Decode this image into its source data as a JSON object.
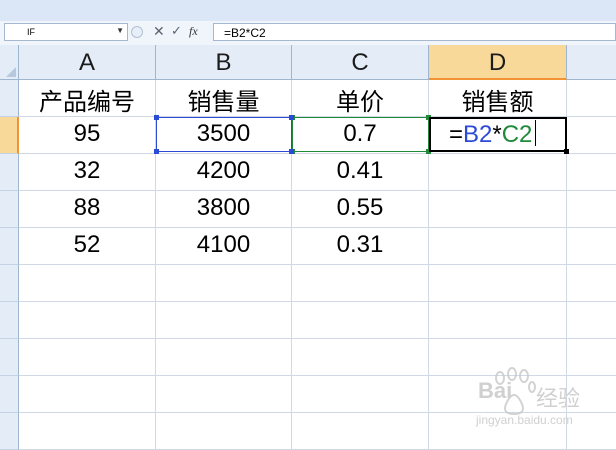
{
  "formula_bar": {
    "name_box": "IF",
    "fx_label": "fx",
    "formula": "=B2*C2"
  },
  "columns": [
    "A",
    "B",
    "C",
    "D"
  ],
  "header_row": {
    "A": "产品编号",
    "B": "销售量",
    "C": "单价",
    "D": "销售额"
  },
  "rows": [
    {
      "A": "95",
      "B": "3500",
      "C": "0.7",
      "D": ""
    },
    {
      "A": "32",
      "B": "4200",
      "C": "0.41",
      "D": ""
    },
    {
      "A": "88",
      "B": "3800",
      "C": "0.55",
      "D": ""
    },
    {
      "A": "52",
      "B": "4100",
      "C": "0.31",
      "D": ""
    }
  ],
  "editing_cell": {
    "eq": "=",
    "ref1": "B2",
    "op": "*",
    "ref2": "C2"
  },
  "colors": {
    "ref1_color": "#2b4ad6",
    "ref2_color": "#1e8a3a",
    "selected_header": "#f9d99a"
  },
  "watermark": {
    "brand": "Bai",
    "brand2": "经验",
    "url": "jingyan.baidu.com"
  }
}
